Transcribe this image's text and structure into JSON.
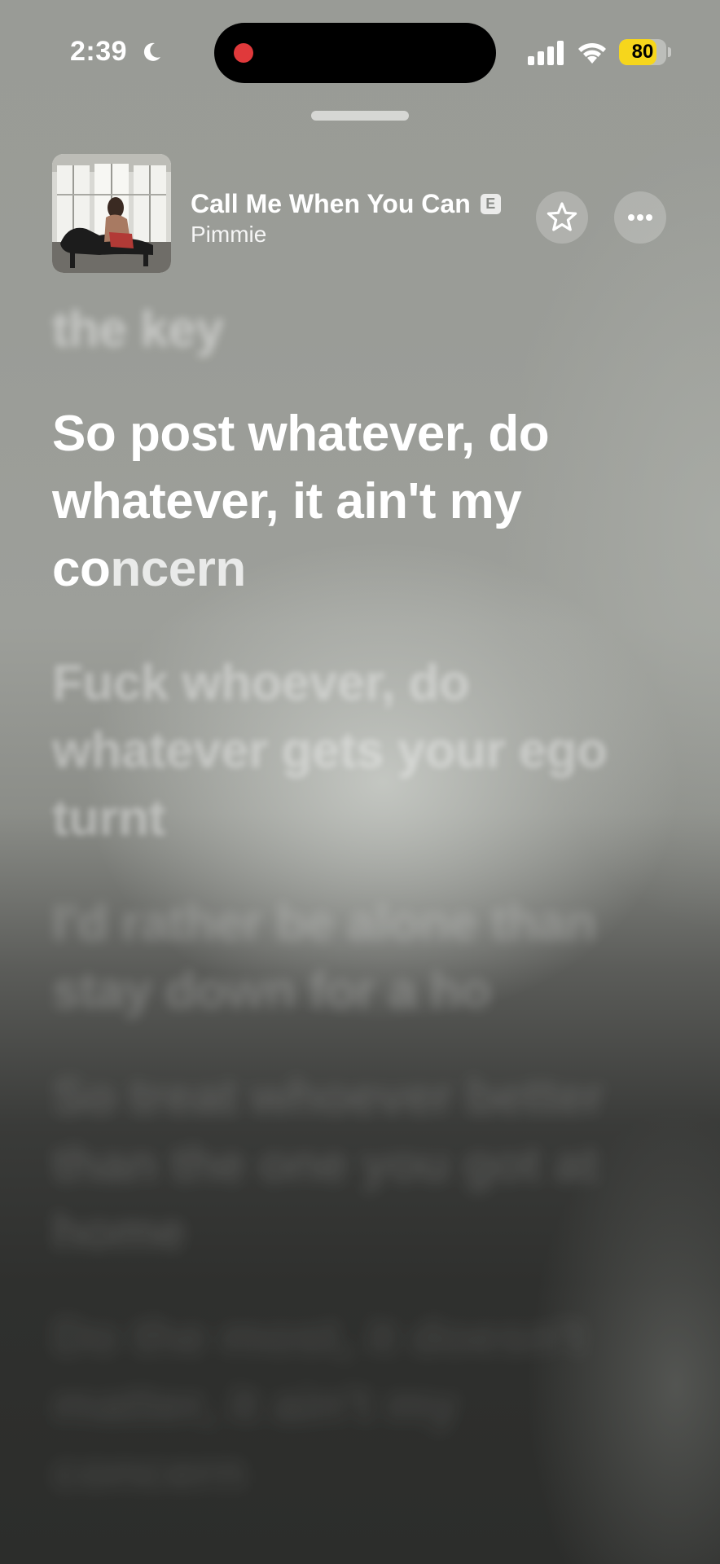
{
  "status_bar": {
    "time": "2:39",
    "battery_percent": "80",
    "battery_level": 0.8,
    "focus_icon": "moon-icon",
    "signal_icon": "cellular-signal-icon",
    "wifi_icon": "wifi-icon",
    "recording_indicator_color": "#e0393b"
  },
  "now_playing": {
    "title": "Call Me When You Can",
    "explicit_badge": "E",
    "artist": "Pimmie",
    "favorite_icon": "star-icon",
    "more_icon": "ellipsis-icon"
  },
  "lyrics": {
    "previous": "the key",
    "current": {
      "line1": "So post whatever, do",
      "line2": "whatever, it ain't my",
      "line3_sung": "co",
      "line3_unsung": "ncern"
    },
    "upcoming": [
      {
        "line1": "Fuck whoever, do",
        "line2": "whatever gets your ego",
        "line3": "turnt"
      },
      {
        "line1": "I'd rather be alone than",
        "line2": "stay down for a ho"
      },
      {
        "line1": "So treat whoever better",
        "line2": "than the one you got at",
        "line3": "home"
      },
      {
        "line1": "Do the most, it doesn't",
        "line2": "matter, it ain't my",
        "line3": "concern"
      }
    ]
  },
  "colors": {
    "accent_battery": "#f6d61c",
    "text": "#ffffff"
  }
}
